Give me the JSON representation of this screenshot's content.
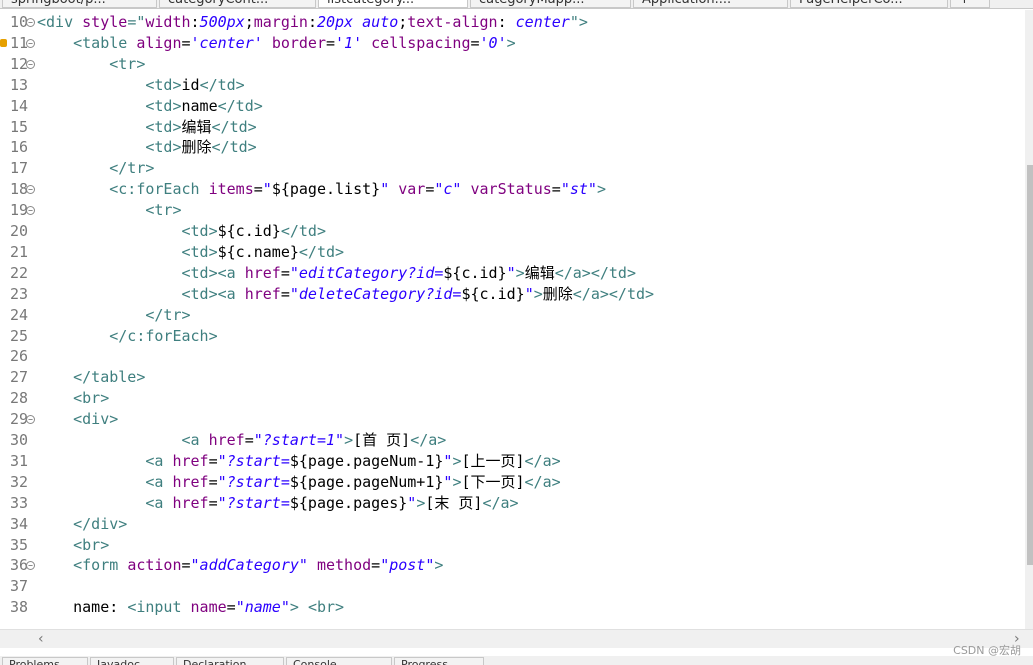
{
  "tabs": [
    {
      "label": "springboot/p...",
      "active": false
    },
    {
      "label": "categoryCont...",
      "active": false
    },
    {
      "label": "listcategory...",
      "active": true
    },
    {
      "label": "categoryMapp...",
      "active": false
    },
    {
      "label": "Application....",
      "active": false
    },
    {
      "label": "PageHelperCo...",
      "active": false
    },
    {
      "label": "↑",
      "active": false
    }
  ],
  "lines": [
    {
      "n": "10",
      "parts": [
        [
          "tag",
          "<div "
        ],
        [
          "attr",
          "style"
        ],
        [
          "tag",
          "=\""
        ],
        [
          "attr",
          "width"
        ],
        [
          "txt",
          ":"
        ],
        [
          "str",
          "500px"
        ],
        [
          "txt",
          ";"
        ],
        [
          "attr",
          "margin"
        ],
        [
          "txt",
          ":"
        ],
        [
          "str",
          "20px auto"
        ],
        [
          "txt",
          ";"
        ],
        [
          "attr",
          "text-align"
        ],
        [
          "txt",
          ": "
        ],
        [
          "str",
          "center"
        ],
        [
          "tag",
          "\">"
        ]
      ]
    },
    {
      "n": "11",
      "parts": [
        [
          "txt",
          "    "
        ],
        [
          "tag",
          "<table "
        ],
        [
          "attr",
          "align"
        ],
        [
          "txt",
          "="
        ],
        [
          "str",
          "'center'"
        ],
        [
          "txt",
          " "
        ],
        [
          "attr",
          "border"
        ],
        [
          "txt",
          "="
        ],
        [
          "str",
          "'1'"
        ],
        [
          "txt",
          " "
        ],
        [
          "attr",
          "cellspacing"
        ],
        [
          "txt",
          "="
        ],
        [
          "str",
          "'0'"
        ],
        [
          "tag",
          ">"
        ]
      ]
    },
    {
      "n": "12",
      "parts": [
        [
          "txt",
          "        "
        ],
        [
          "tag",
          "<tr>"
        ]
      ]
    },
    {
      "n": "13",
      "parts": [
        [
          "txt",
          "            "
        ],
        [
          "tag",
          "<td>"
        ],
        [
          "txt",
          "id"
        ],
        [
          "tag",
          "</td>"
        ]
      ]
    },
    {
      "n": "14",
      "parts": [
        [
          "txt",
          "            "
        ],
        [
          "tag",
          "<td>"
        ],
        [
          "txt",
          "name"
        ],
        [
          "tag",
          "</td>"
        ]
      ]
    },
    {
      "n": "15",
      "parts": [
        [
          "txt",
          "            "
        ],
        [
          "tag",
          "<td>"
        ],
        [
          "txt",
          "编辑"
        ],
        [
          "tag",
          "</td>"
        ]
      ]
    },
    {
      "n": "16",
      "parts": [
        [
          "txt",
          "            "
        ],
        [
          "tag",
          "<td>"
        ],
        [
          "txt",
          "删除"
        ],
        [
          "tag",
          "</td>"
        ]
      ]
    },
    {
      "n": "17",
      "parts": [
        [
          "txt",
          "        "
        ],
        [
          "tag",
          "</tr>"
        ]
      ]
    },
    {
      "n": "18",
      "parts": [
        [
          "txt",
          "        "
        ],
        [
          "tag",
          "<c:forEach "
        ],
        [
          "attr",
          "items"
        ],
        [
          "txt",
          "="
        ],
        [
          "str",
          "\""
        ],
        [
          "txt",
          "${page.list}"
        ],
        [
          "str",
          "\""
        ],
        [
          "txt",
          " "
        ],
        [
          "attr",
          "var"
        ],
        [
          "txt",
          "="
        ],
        [
          "str",
          "\"c\""
        ],
        [
          "txt",
          " "
        ],
        [
          "attr",
          "varStatus"
        ],
        [
          "txt",
          "="
        ],
        [
          "str",
          "\"st\""
        ],
        [
          "tag",
          ">"
        ]
      ]
    },
    {
      "n": "19",
      "parts": [
        [
          "txt",
          "            "
        ],
        [
          "tag",
          "<tr>"
        ]
      ]
    },
    {
      "n": "20",
      "parts": [
        [
          "txt",
          "                "
        ],
        [
          "tag",
          "<td>"
        ],
        [
          "txt",
          "${c.id}"
        ],
        [
          "tag",
          "</td>"
        ]
      ]
    },
    {
      "n": "21",
      "parts": [
        [
          "txt",
          "                "
        ],
        [
          "tag",
          "<td>"
        ],
        [
          "txt",
          "${c.name}"
        ],
        [
          "tag",
          "</td>"
        ]
      ]
    },
    {
      "n": "22",
      "parts": [
        [
          "txt",
          "                "
        ],
        [
          "tag",
          "<td><a "
        ],
        [
          "attr",
          "href"
        ],
        [
          "txt",
          "="
        ],
        [
          "str",
          "\"editCategory?id="
        ],
        [
          "txt",
          "${c.id}"
        ],
        [
          "str",
          "\""
        ],
        [
          "tag",
          ">"
        ],
        [
          "txt",
          "编辑"
        ],
        [
          "tag",
          "</a></td>"
        ]
      ]
    },
    {
      "n": "23",
      "parts": [
        [
          "txt",
          "                "
        ],
        [
          "tag",
          "<td><a "
        ],
        [
          "attr",
          "href"
        ],
        [
          "txt",
          "="
        ],
        [
          "str",
          "\"deleteCategory?id="
        ],
        [
          "txt",
          "${c.id}"
        ],
        [
          "str",
          "\""
        ],
        [
          "tag",
          ">"
        ],
        [
          "txt",
          "删除"
        ],
        [
          "tag",
          "</a></td>"
        ]
      ]
    },
    {
      "n": "24",
      "parts": [
        [
          "txt",
          "            "
        ],
        [
          "tag",
          "</tr>"
        ]
      ]
    },
    {
      "n": "25",
      "parts": [
        [
          "txt",
          "        "
        ],
        [
          "tag",
          "</c:forEach>"
        ]
      ]
    },
    {
      "n": "26",
      "parts": []
    },
    {
      "n": "27",
      "parts": [
        [
          "txt",
          "    "
        ],
        [
          "tag",
          "</table>"
        ]
      ]
    },
    {
      "n": "28",
      "parts": [
        [
          "txt",
          "    "
        ],
        [
          "tag",
          "<br>"
        ]
      ]
    },
    {
      "n": "29",
      "parts": [
        [
          "txt",
          "    "
        ],
        [
          "tag",
          "<div>"
        ]
      ]
    },
    {
      "n": "30",
      "parts": [
        [
          "txt",
          "                "
        ],
        [
          "tag",
          "<a "
        ],
        [
          "attr",
          "href"
        ],
        [
          "txt",
          "="
        ],
        [
          "str",
          "\"?start=1\""
        ],
        [
          "tag",
          ">"
        ],
        [
          "txt",
          "[首 页]"
        ],
        [
          "tag",
          "</a>"
        ]
      ]
    },
    {
      "n": "31",
      "parts": [
        [
          "txt",
          "            "
        ],
        [
          "tag",
          "<a "
        ],
        [
          "attr",
          "href"
        ],
        [
          "txt",
          "="
        ],
        [
          "str",
          "\"?start="
        ],
        [
          "txt",
          "${page.pageNum-1}"
        ],
        [
          "str",
          "\""
        ],
        [
          "tag",
          ">"
        ],
        [
          "txt",
          "[上一页]"
        ],
        [
          "tag",
          "</a>"
        ]
      ]
    },
    {
      "n": "32",
      "parts": [
        [
          "txt",
          "            "
        ],
        [
          "tag",
          "<a "
        ],
        [
          "attr",
          "href"
        ],
        [
          "txt",
          "="
        ],
        [
          "str",
          "\"?start="
        ],
        [
          "txt",
          "${page.pageNum+1}"
        ],
        [
          "str",
          "\""
        ],
        [
          "tag",
          ">"
        ],
        [
          "txt",
          "[下一页]"
        ],
        [
          "tag",
          "</a>"
        ]
      ]
    },
    {
      "n": "33",
      "parts": [
        [
          "txt",
          "            "
        ],
        [
          "tag",
          "<a "
        ],
        [
          "attr",
          "href"
        ],
        [
          "txt",
          "="
        ],
        [
          "str",
          "\"?start="
        ],
        [
          "txt",
          "${page.pages}"
        ],
        [
          "str",
          "\""
        ],
        [
          "tag",
          ">"
        ],
        [
          "txt",
          "[末 页]"
        ],
        [
          "tag",
          "</a>"
        ]
      ]
    },
    {
      "n": "34",
      "parts": [
        [
          "txt",
          "    "
        ],
        [
          "tag",
          "</div>"
        ]
      ]
    },
    {
      "n": "35",
      "parts": [
        [
          "txt",
          "    "
        ],
        [
          "tag",
          "<br>"
        ]
      ]
    },
    {
      "n": "36",
      "parts": [
        [
          "txt",
          "    "
        ],
        [
          "tag",
          "<form "
        ],
        [
          "attr",
          "action"
        ],
        [
          "txt",
          "="
        ],
        [
          "str",
          "\"addCategory\""
        ],
        [
          "txt",
          " "
        ],
        [
          "attr",
          "method"
        ],
        [
          "txt",
          "="
        ],
        [
          "str",
          "\"post\""
        ],
        [
          "tag",
          ">"
        ]
      ]
    },
    {
      "n": "37",
      "parts": []
    },
    {
      "n": "38",
      "parts": [
        [
          "txt",
          "    name: "
        ],
        [
          "tag",
          "<input "
        ],
        [
          "attr",
          "name"
        ],
        [
          "txt",
          "="
        ],
        [
          "str",
          "\"name\""
        ],
        [
          "tag",
          ">"
        ],
        [
          "txt",
          " "
        ],
        [
          "tag",
          "<br>"
        ]
      ]
    }
  ],
  "fold_lines": [
    "10",
    "11",
    "12",
    "18",
    "19",
    "29",
    "36"
  ],
  "warn_lines": [
    "11"
  ],
  "bottom_tabs": [
    "Problems",
    "Javadoc",
    "Declaration",
    "Console",
    "Progress"
  ],
  "watermark": "CSDN @宏胡",
  "colors": {
    "tag": "#3f7f7f",
    "attr": "#7f007f",
    "string": "#2a00ff",
    "text": "#000000",
    "linenum": "#787878"
  }
}
